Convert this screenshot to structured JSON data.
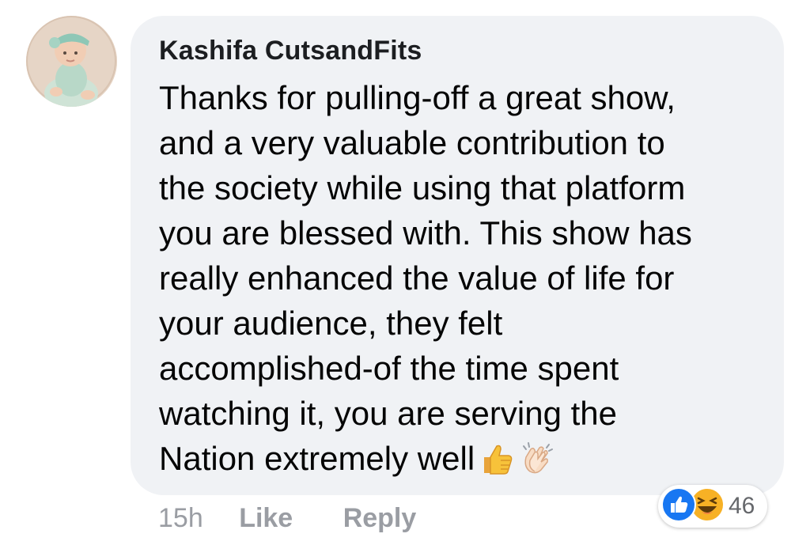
{
  "comment": {
    "author": "Kashifa CutsandFits",
    "text_lines": [
      "Thanks for pulling-off a great show,",
      "and a very valuable contribution to",
      "the society while using that platform",
      "you are blessed with. This show has",
      "really enhanced the value of life for",
      "your audience, they felt",
      "accomplished-of the time spent",
      "watching it, you are serving the",
      "Nation extremely well"
    ],
    "inline_emojis": [
      "thumbs-up-emoji",
      "clapping-hands-emoji"
    ],
    "timestamp": "15h",
    "like_label": "Like",
    "reply_label": "Reply",
    "reactions": {
      "types": [
        "like-icon",
        "haha-icon"
      ],
      "count": "46"
    }
  },
  "colors": {
    "bubble_bg": "#f0f2f5",
    "text": "#050505",
    "muted": "#9a9da3",
    "like_blue": "#1877f2",
    "haha_yellow": "#f7b125"
  }
}
